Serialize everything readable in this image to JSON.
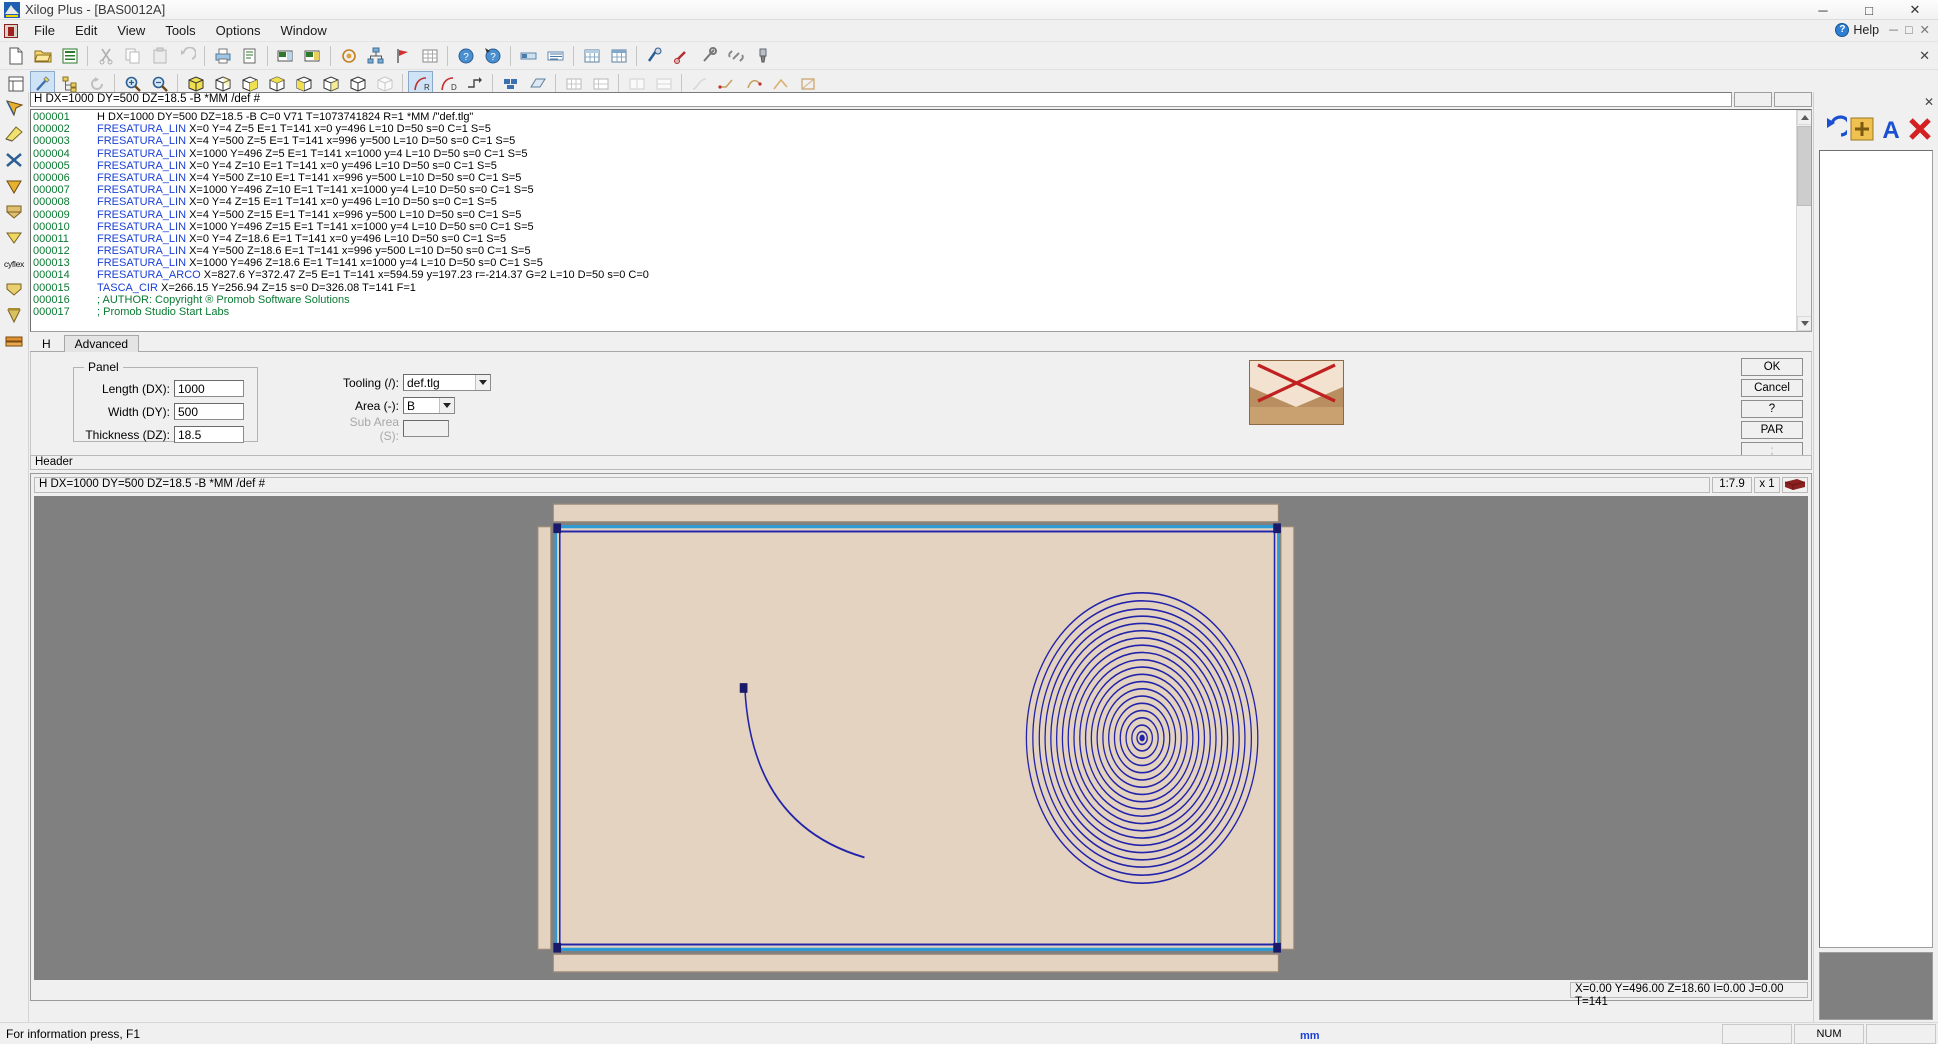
{
  "window": {
    "title": "Xilog Plus - [BAS0012A]",
    "app_icon": "xilog-logo-icon",
    "minimize": "─",
    "maximize": "□",
    "close": "✕"
  },
  "menubar": {
    "items": [
      "File",
      "Edit",
      "View",
      "Tools",
      "Options",
      "Window"
    ],
    "help_label": "Help",
    "child_minimize": "─",
    "child_maximize": "□",
    "child_close": "✕"
  },
  "toolbar_close": "✕",
  "header_field": {
    "value": "H DX=1000 DY=500 DZ=18.5 -B *MM /def #"
  },
  "code": {
    "lines": [
      {
        "num": "000001",
        "cmd": "",
        "args": "H DX=1000 DY=500 DZ=18.5 -B C=0 V71 T=1073741824 R=1 *MM /\"def.tlg\"",
        "type": "header"
      },
      {
        "num": "000002",
        "cmd": "FRESATURA_LIN",
        "args": "X=0 Y=4 Z=5 E=1 T=141 x=0 y=496 L=10 D=50 s=0 C=1 S=5",
        "type": "cmd"
      },
      {
        "num": "000003",
        "cmd": "FRESATURA_LIN",
        "args": "X=4 Y=500 Z=5 E=1 T=141 x=996 y=500 L=10 D=50 s=0 C=1 S=5",
        "type": "cmd"
      },
      {
        "num": "000004",
        "cmd": "FRESATURA_LIN",
        "args": "X=1000 Y=496 Z=5 E=1 T=141 x=1000 y=4 L=10 D=50 s=0 C=1 S=5",
        "type": "cmd"
      },
      {
        "num": "000005",
        "cmd": "FRESATURA_LIN",
        "args": "X=0 Y=4 Z=10 E=1 T=141 x=0 y=496 L=10 D=50 s=0 C=1 S=5",
        "type": "cmd"
      },
      {
        "num": "000006",
        "cmd": "FRESATURA_LIN",
        "args": "X=4 Y=500 Z=10 E=1 T=141 x=996 y=500 L=10 D=50 s=0 C=1 S=5",
        "type": "cmd"
      },
      {
        "num": "000007",
        "cmd": "FRESATURA_LIN",
        "args": "X=1000 Y=496 Z=10 E=1 T=141 x=1000 y=4 L=10 D=50 s=0 C=1 S=5",
        "type": "cmd"
      },
      {
        "num": "000008",
        "cmd": "FRESATURA_LIN",
        "args": "X=0 Y=4 Z=15 E=1 T=141 x=0 y=496 L=10 D=50 s=0 C=1 S=5",
        "type": "cmd"
      },
      {
        "num": "000009",
        "cmd": "FRESATURA_LIN",
        "args": "X=4 Y=500 Z=15 E=1 T=141 x=996 y=500 L=10 D=50 s=0 C=1 S=5",
        "type": "cmd"
      },
      {
        "num": "000010",
        "cmd": "FRESATURA_LIN",
        "args": "X=1000 Y=496 Z=15 E=1 T=141 x=1000 y=4 L=10 D=50 s=0 C=1 S=5",
        "type": "cmd"
      },
      {
        "num": "000011",
        "cmd": "FRESATURA_LIN",
        "args": "X=0 Y=4 Z=18.6 E=1 T=141 x=0 y=496 L=10 D=50 s=0 C=1 S=5",
        "type": "cmd"
      },
      {
        "num": "000012",
        "cmd": "FRESATURA_LIN",
        "args": "X=4 Y=500 Z=18.6 E=1 T=141 x=996 y=500 L=10 D=50 s=0 C=1 S=5",
        "type": "cmd"
      },
      {
        "num": "000013",
        "cmd": "FRESATURA_LIN",
        "args": "X=1000 Y=496 Z=18.6 E=1 T=141 x=1000 y=4 L=10 D=50 s=0 C=1 S=5",
        "type": "cmd"
      },
      {
        "num": "000014",
        "cmd": "FRESATURA_ARCO",
        "args": "X=827.6 Y=372.47 Z=5 E=1 T=141 x=594.59 y=197.23 r=-214.37 G=2 L=10 D=50 s=0 C=0",
        "type": "cmd"
      },
      {
        "num": "000015",
        "cmd": "TASCA_CIR",
        "args": "X=266.15 Y=256.94 Z=15 s=0 D=326.08 T=141 F=1",
        "type": "cmd"
      },
      {
        "num": "000016",
        "cmd": "",
        "args": "; AUTHOR: Copyright ® Promob Software Solutions",
        "type": "comment"
      },
      {
        "num": "000017",
        "cmd": "",
        "args": "; Promob Studio Start Labs",
        "type": "comment"
      }
    ]
  },
  "tabs": [
    {
      "label": "H",
      "selected": true
    },
    {
      "label": "Advanced",
      "selected": false
    }
  ],
  "form": {
    "group_title": "Panel",
    "fields": [
      {
        "label": "Length (DX):",
        "value": "1000"
      },
      {
        "label": "Width (DY):",
        "value": "500"
      },
      {
        "label": "Thickness (DZ):",
        "value": "18.5"
      }
    ],
    "tooling_label": "Tooling (/):",
    "tooling_value": "def.tlg",
    "area_label": "Area (-):",
    "area_value": "B",
    "subarea_label": "Sub Area (S):",
    "subarea_value": ""
  },
  "dialog_buttons": [
    {
      "label": "OK",
      "enabled": true
    },
    {
      "label": "Cancel",
      "enabled": true
    },
    {
      "label": "?",
      "enabled": true
    },
    {
      "label": "PAR",
      "enabled": true
    },
    {
      "label": ";",
      "enabled": false
    }
  ],
  "header_bar": {
    "label": "Header"
  },
  "viewport": {
    "title": "H DX=1000 DY=500 DZ=18.5 -B *MM /def #",
    "scale": "1:7.9",
    "multiplier": "x 1",
    "view_icon": "panel-3d-icon",
    "coords": "X=0.00 Y=496.00 Z=18.60 I=0.00 J=0.00 T=141",
    "background_color": "#808080",
    "panel_color": "#e3d3c0",
    "geometry_color": "#2222aa",
    "edge_color": "#2d9bd4"
  },
  "right_panel": {
    "close": "✕",
    "tools": [
      {
        "name": "undo-arrow-icon",
        "color": "#1a4fd0"
      },
      {
        "name": "add-plus-icon",
        "color": "#e8a020"
      },
      {
        "name": "text-a-icon",
        "color": "#1a4fd0"
      },
      {
        "name": "delete-x-icon",
        "color": "#d42020"
      }
    ]
  },
  "statusbar": {
    "message": "For information press, F1",
    "unit": "mm",
    "num_indicator": "NUM",
    "cells": [
      "",
      "NUM",
      ""
    ]
  },
  "left_rail": {
    "items": [
      "select-arrow-icon",
      "edge-tool-icon",
      "cross-tool-icon",
      "arrow-down-icon",
      "shape-tool-icon",
      "v-shape-icon",
      "cyflex-label",
      "pocket-icon",
      "drill-icon",
      "stack-icon"
    ],
    "label": "cyflex"
  },
  "toolbar_row1": {
    "icons": [
      "new-file-icon",
      "open-folder-icon",
      "save-icon",
      "cut-icon",
      "copy-icon",
      "paste-icon",
      "undo-icon",
      "print-icon",
      "preview-icon",
      "machine1-icon",
      "machine2-icon",
      "target-icon",
      "network-icon",
      "flag-icon",
      "grid-icon",
      "help-icon",
      "help-arrow-icon",
      "bar1-icon",
      "bar2-icon",
      "table1-icon",
      "table2-icon",
      "tool1-icon",
      "tool2-icon",
      "wrench-icon",
      "chain-icon",
      "spindle-icon"
    ]
  },
  "toolbar_row2": {
    "icons": [
      "layout-icon",
      "wand-icon",
      "tree-icon",
      "rotate-icon",
      "zoom-in-icon",
      "zoom-out-icon",
      "cube-solid-icon",
      "cube-wire1-icon",
      "cube-wire2-icon",
      "cube-wire3-icon",
      "cube-wire4-icon",
      "cube-wire5-icon",
      "cube-wire6-icon",
      "cube-gray-icon",
      "curve-r-icon",
      "curve-d-icon",
      "arrow-path-icon",
      "blue-block-icon",
      "blue-plane-icon",
      "grid-a-icon",
      "grid-b-icon",
      "grid-c-icon",
      "grid-d-icon",
      "path1-icon",
      "path2-icon",
      "path3-icon",
      "path4-icon",
      "path5-icon"
    ]
  }
}
